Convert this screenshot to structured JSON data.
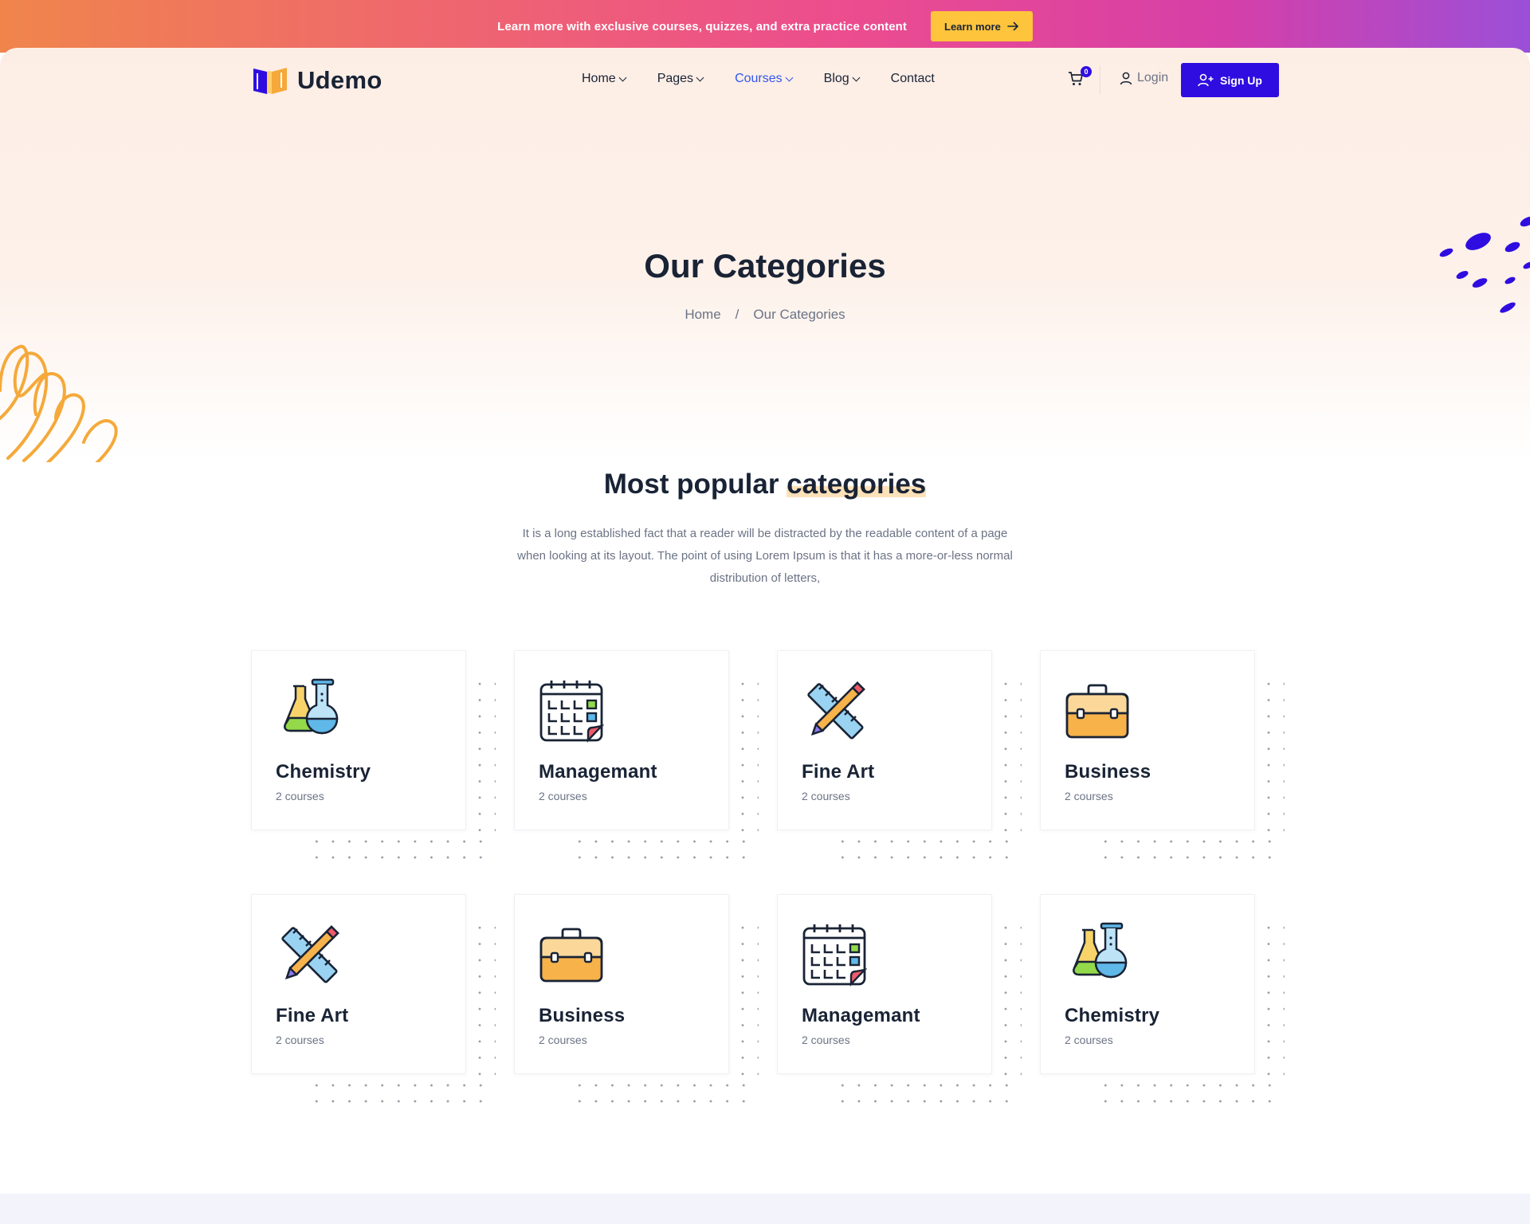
{
  "announcement": {
    "text": "Learn more with exclusive courses, quizzes, and extra practice content",
    "button_label": "Learn more"
  },
  "header": {
    "logo_text": "Udemo",
    "nav": [
      {
        "label": "Home",
        "has_dropdown": true
      },
      {
        "label": "Pages",
        "has_dropdown": true
      },
      {
        "label": "Courses",
        "has_dropdown": true,
        "active": true
      },
      {
        "label": "Blog",
        "has_dropdown": true
      },
      {
        "label": "Contact",
        "has_dropdown": false
      }
    ],
    "cart_count": "0",
    "login_label": "Login",
    "signup_label": "Sign Up"
  },
  "hero": {
    "title": "Our Categories",
    "breadcrumb": [
      "Home",
      "/",
      "Our Categories"
    ]
  },
  "section": {
    "title_plain": "Most popular ",
    "title_highlight": "categories",
    "description": "It is a long established fact that a reader will be distracted by the readable content of a page when looking at its layout. The point of using Lorem Ipsum is that it has a more-or-less normal distribution of letters,"
  },
  "categories": [
    {
      "name": "Chemistry",
      "count": "2 courses",
      "icon": "chemistry-flask-icon"
    },
    {
      "name": "Managemant",
      "count": "2 courses",
      "icon": "calendar-icon"
    },
    {
      "name": "Fine Art",
      "count": "2 courses",
      "icon": "ruler-pencil-icon"
    },
    {
      "name": "Business",
      "count": "2 courses",
      "icon": "briefcase-icon"
    },
    {
      "name": "Fine Art",
      "count": "2 courses",
      "icon": "ruler-pencil-icon"
    },
    {
      "name": "Business",
      "count": "2 courses",
      "icon": "briefcase-icon"
    },
    {
      "name": "Managemant",
      "count": "2 courses",
      "icon": "calendar-icon"
    },
    {
      "name": "Chemistry",
      "count": "2 courses",
      "icon": "chemistry-flask-icon"
    }
  ],
  "colors": {
    "primary": "#2f0de0",
    "accent_yellow": "#fdc43c",
    "heading": "#192335",
    "body_text": "#6b7385",
    "highlight": "#fde1b8"
  }
}
